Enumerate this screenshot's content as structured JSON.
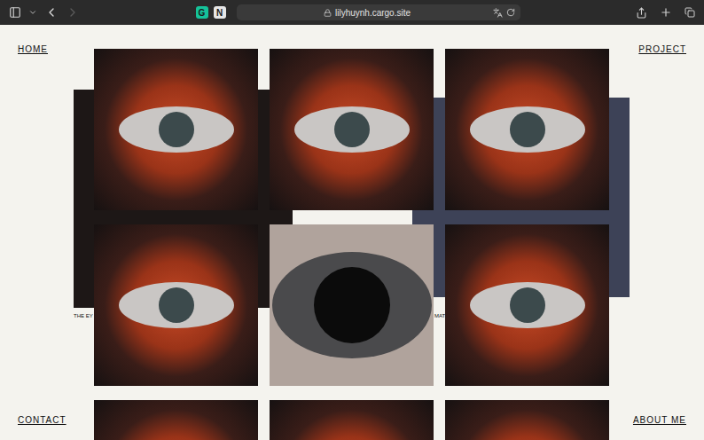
{
  "browser": {
    "url": "lilyhuynh.cargo.site",
    "back_enabled": true,
    "forward_enabled": false,
    "extensions": [
      {
        "label": "G",
        "color": "#15c39a"
      },
      {
        "label": "N",
        "color": "#e6e6e6"
      }
    ]
  },
  "nav": [
    {
      "label": "HOME",
      "corner": "top-left"
    },
    {
      "label": "PROJECT",
      "corner": "top-right"
    },
    {
      "label": "CONTACT",
      "corner": "bottom-left"
    },
    {
      "label": "ABOUT ME",
      "corner": "bottom-right"
    }
  ],
  "captions": [
    {
      "text": "THE EY",
      "side": "left"
    },
    {
      "text": "MAT",
      "side": "right"
    }
  ],
  "gallery": [
    {
      "kind": "painting"
    },
    {
      "kind": "painting"
    },
    {
      "kind": "painting"
    },
    {
      "kind": "painting"
    },
    {
      "kind": "photo"
    },
    {
      "kind": "painting"
    },
    {
      "kind": "painting"
    },
    {
      "kind": "painting"
    },
    {
      "kind": "painting"
    }
  ]
}
